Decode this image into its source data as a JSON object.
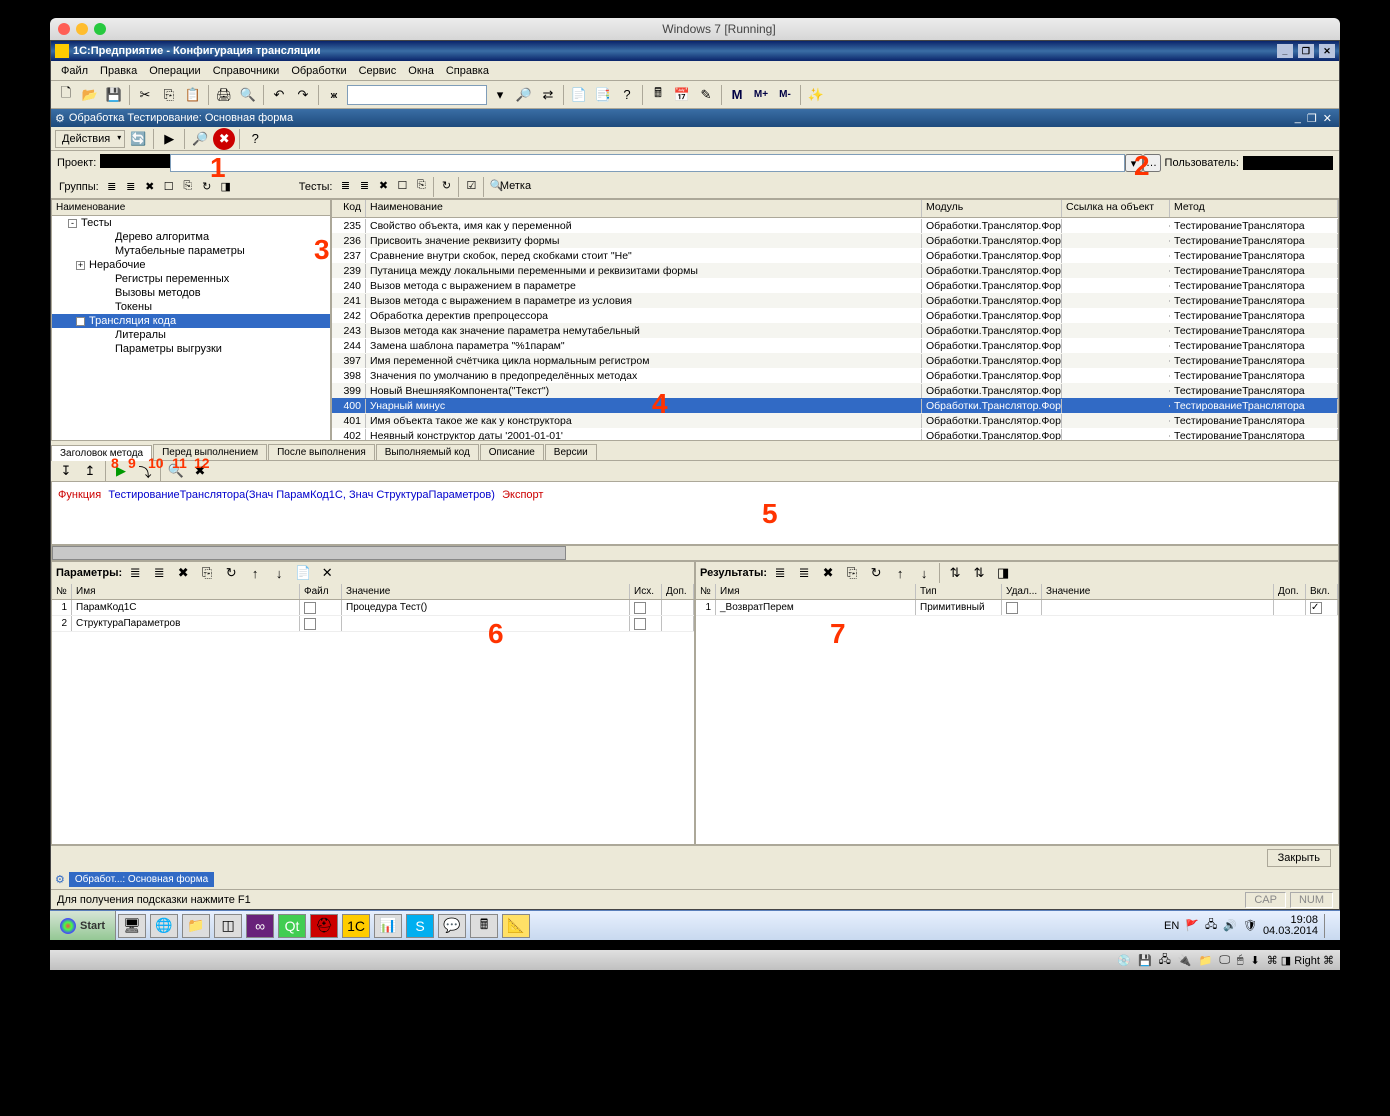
{
  "mac": {
    "title": "Windows 7 [Running]",
    "right": "⌘ ◨ Right ⌘"
  },
  "app": {
    "title": "1С:Предприятие - Конфигурация трансляции",
    "menus": [
      "Файл",
      "Правка",
      "Операции",
      "Справочники",
      "Обработки",
      "Сервис",
      "Окна",
      "Справка"
    ],
    "form_title": "Обработка Тестирование: Основная форма",
    "actions_label": "Действия",
    "project_label": "Проект:",
    "user_label": "Пользователь:",
    "groups_label": "Группы:",
    "tests_label": "Тесты:",
    "label_marker": "Метка",
    "tree_header": "Наименование",
    "tree": [
      {
        "t": "Тесты",
        "lvl": 0,
        "exp": "-"
      },
      {
        "t": "Дерево алгоритма",
        "lvl": 2
      },
      {
        "t": "Мутабельные параметры",
        "lvl": 2
      },
      {
        "t": "Нерабочие",
        "lvl": 1,
        "exp": "+"
      },
      {
        "t": "Регистры переменных",
        "lvl": 2
      },
      {
        "t": "Вызовы методов",
        "lvl": 2
      },
      {
        "t": "Токены",
        "lvl": 2
      },
      {
        "t": "Трансляция кода",
        "lvl": 1,
        "exp": "-",
        "sel": true
      },
      {
        "t": "Литералы",
        "lvl": 2
      },
      {
        "t": "Параметры выгрузки",
        "lvl": 2
      }
    ],
    "grid_headers": {
      "kod": "Код",
      "name": "Наименование",
      "mod": "Модуль",
      "link": "Ссылка на объект",
      "meth": "Метод"
    },
    "grid_module": "Обработки.Транслятор.Фор...",
    "grid_method": "ТестированиеТранслятора",
    "grid_rows": [
      {
        "k": 235,
        "n": "Свойство объекта, имя как у переменной"
      },
      {
        "k": 236,
        "n": "Присвоить значение реквизиту формы"
      },
      {
        "k": 237,
        "n": "Сравнение внутри скобок, перед скобками стоит \"Не\""
      },
      {
        "k": 239,
        "n": "Путаница между локальными переменными и реквизитами формы"
      },
      {
        "k": 240,
        "n": "Вызов метода с выражением в параметре"
      },
      {
        "k": 241,
        "n": "Вызов метода с выражением в параметре из условия"
      },
      {
        "k": 242,
        "n": "Обработка деректив препроцессора"
      },
      {
        "k": 243,
        "n": "Вызов метода как значение параметра немутабельный"
      },
      {
        "k": 244,
        "n": "Замена шаблона параметра \"%1парам\""
      },
      {
        "k": 397,
        "n": "Имя переменной счётчика цикла нормальным регистром"
      },
      {
        "k": 398,
        "n": "Значения по умолчанию в предопределённых методах"
      },
      {
        "k": 399,
        "n": "Новый ВнешняяКомпонента(\"Текст\")"
      },
      {
        "k": 400,
        "n": "Унарный минус",
        "sel": true
      },
      {
        "k": 401,
        "n": "Имя объекта такое же как у конструктора"
      },
      {
        "k": 402,
        "n": "Неявный конструктор даты '2001-01-01'"
      }
    ],
    "tabs": [
      "Заголовок метода",
      "Перед выполнением",
      "После выполнения",
      "Выполняемый код",
      "Описание",
      "Версии"
    ],
    "code": {
      "kw1": "Функция",
      "id": "ТестированиеТранслятора",
      "p": "(Знач ПарамКод1С, Знач СтруктураПараметров)",
      "kw2": "Экспорт"
    },
    "params_label": "Параметры:",
    "results_label": "Результаты:",
    "params_headers": {
      "n": "№",
      "name": "Имя",
      "file": "Файл",
      "val": "Значение",
      "src": "Исх.",
      "ext": "Доп."
    },
    "params_rows": [
      {
        "n": 1,
        "name": "ПарамКод1С",
        "val": ""
      },
      {
        "n": 2,
        "name": "СтруктураПараметров",
        "val": "Процедура Тест()"
      }
    ],
    "results_headers": {
      "n": "№",
      "name": "Имя",
      "type": "Тип",
      "del": "Удал...",
      "val": "Значение",
      "ext": "Доп.",
      "inc": "Вкл."
    },
    "results_rows": [
      {
        "n": 1,
        "name": "_ВозвратПерем",
        "type": "Примитивный",
        "inc": true
      }
    ],
    "close_btn": "Закрыть",
    "doc_tab": "Обработ...: Основная форма",
    "status_hint": "Для получения подсказки нажмите F1",
    "status_cap": "CAP",
    "status_num": "NUM"
  },
  "taskbar": {
    "start": "Start",
    "lang": "EN",
    "time": "19:08",
    "date": "04.03.2014"
  },
  "annotations": [
    "1",
    "2",
    "3",
    "4",
    "5",
    "6",
    "7",
    "8",
    "9",
    "10",
    "11",
    "12"
  ]
}
